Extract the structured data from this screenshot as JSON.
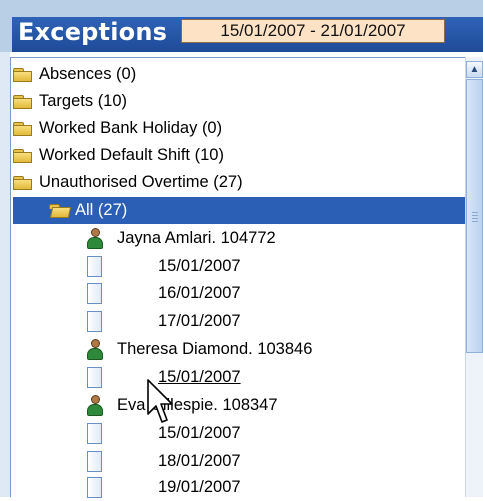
{
  "header": {
    "title": "Exceptions",
    "date_range": "15/01/2007 - 21/01/2007"
  },
  "tree": {
    "items": [
      {
        "type": "folder",
        "label": "Absences (0)",
        "icon": "folder-icon"
      },
      {
        "type": "folder",
        "label": "Targets (10)",
        "icon": "folder-icon"
      },
      {
        "type": "folder",
        "label": "Worked Bank Holiday (0)",
        "icon": "folder-icon"
      },
      {
        "type": "folder",
        "label": "Worked Default Shift (10)",
        "icon": "folder-icon"
      },
      {
        "type": "folder",
        "label": "Unauthorised Overtime (27)",
        "icon": "folder-icon"
      },
      {
        "type": "folder",
        "label": "All (27)",
        "icon": "folder-open-icon",
        "selected": true
      },
      {
        "type": "person",
        "label": "Jayna Amlari. 104772",
        "icon": "person-icon"
      },
      {
        "type": "date",
        "label": "15/01/2007",
        "icon": "document-icon"
      },
      {
        "type": "date",
        "label": "16/01/2007",
        "icon": "document-icon"
      },
      {
        "type": "date",
        "label": "17/01/2007",
        "icon": "document-icon"
      },
      {
        "type": "person",
        "label": "Theresa Diamond. 103846",
        "icon": "person-icon"
      },
      {
        "type": "date",
        "label": "15/01/2007",
        "icon": "document-icon",
        "hovered": true
      },
      {
        "type": "person",
        "label": "Eva Gillespie. 108347",
        "icon": "person-icon"
      },
      {
        "type": "date",
        "label": "15/01/2007",
        "icon": "document-icon"
      },
      {
        "type": "date",
        "label": "18/01/2007",
        "icon": "document-icon"
      },
      {
        "type": "date",
        "label": "19/01/2007",
        "icon": "document-icon"
      }
    ]
  },
  "colors": {
    "header_bg": "#1f4a98",
    "date_box_bg": "#fde2c6",
    "selection_bg": "#2a5fb5"
  }
}
